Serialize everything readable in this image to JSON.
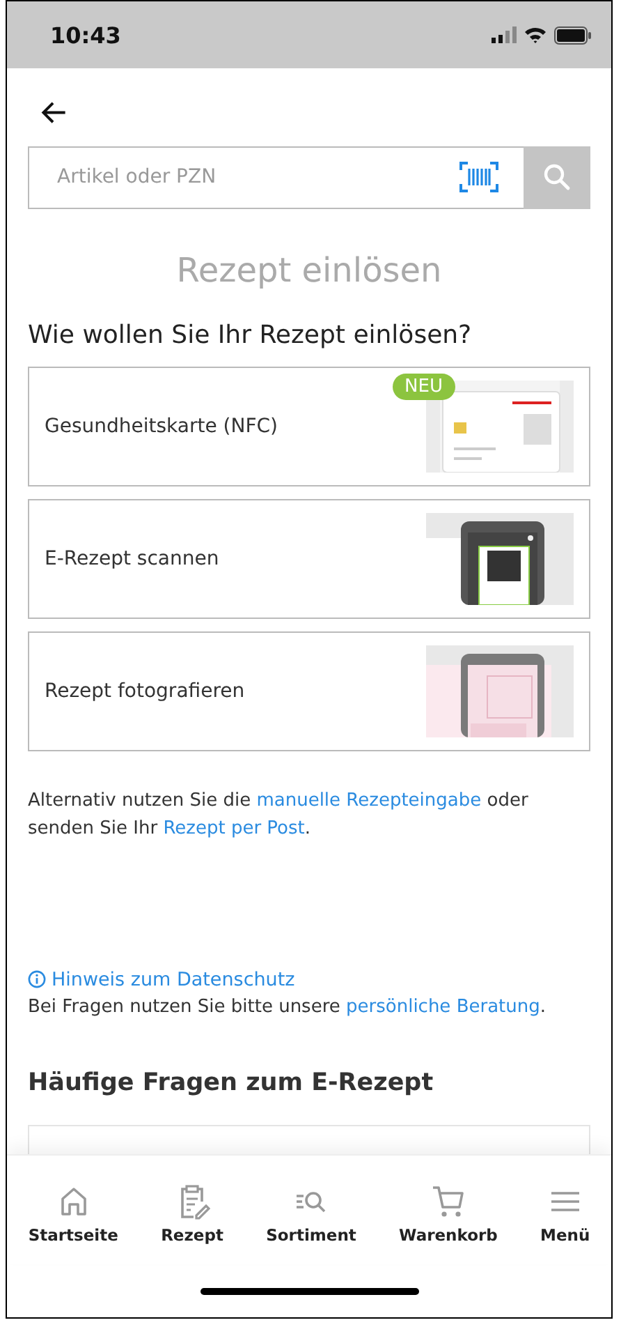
{
  "status_bar": {
    "time": "10:43"
  },
  "search": {
    "placeholder": "Artikel oder PZN"
  },
  "title": "Rezept einlösen",
  "question": "Wie wollen Sie Ihr Rezept einlösen?",
  "options": [
    {
      "label": "Gesundheitskarte (NFC)",
      "badge": "NEU"
    },
    {
      "label": "E-Rezept scannen"
    },
    {
      "label": "Rezept fotografieren"
    }
  ],
  "alternative": [
    {
      "text": "Alternativ nutzen Sie die ",
      "kind": "text"
    },
    {
      "text": "manuelle Rezepteingabe",
      "kind": "link"
    },
    {
      "text": " oder senden Sie Ihr ",
      "kind": "text"
    },
    {
      "text": "Rezept per Post",
      "kind": "link"
    },
    {
      "text": ".",
      "kind": "text"
    }
  ],
  "privacy_link": "Hinweis zum Datenschutz",
  "help": [
    {
      "text": "Bei Fragen nutzen Sie bitte unsere ",
      "kind": "text"
    },
    {
      "text": "persönliche Beratung",
      "kind": "link"
    },
    {
      "text": ".",
      "kind": "text"
    }
  ],
  "faq_heading": "Häufige Fragen zum E-Rezept",
  "nav": [
    {
      "label": "Startseite"
    },
    {
      "label": "Rezept"
    },
    {
      "label": "Sortiment"
    },
    {
      "label": "Warenkorb"
    },
    {
      "label": "Menü"
    }
  ]
}
